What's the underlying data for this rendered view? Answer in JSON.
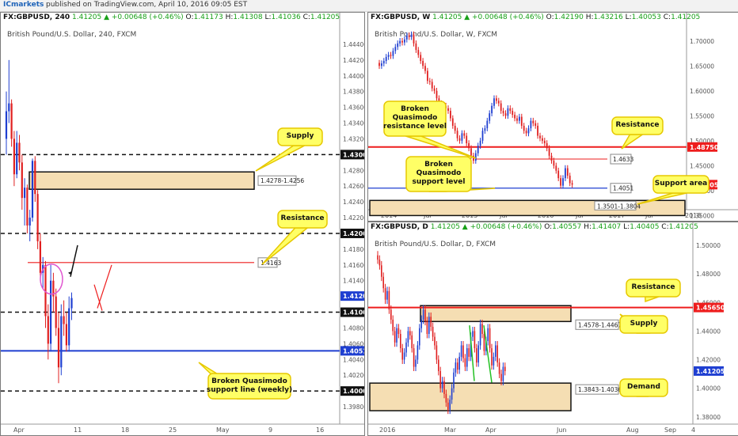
{
  "header": {
    "brand": "ICmarkets",
    "published_text": "published on TradingView.com, April 10, 2016 09:05 EST"
  },
  "colors": {
    "bull": "#1f3fd1",
    "bear": "#e02020",
    "zone_fill": "#f5deb3",
    "callout_fill": "#ffff66",
    "callout_border": "#e6c800",
    "resistance": "#ee1d1d",
    "support": "#1f3fd1"
  },
  "chart_data": [
    {
      "type": "candlestick",
      "ohlc_header": {
        "symbol": "FX:GBPUSD, 240",
        "change": "1.41205 ▲ +0.00648 (+0.46%)",
        "o": "1.41173",
        "h": "1.41308",
        "l": "1.41036",
        "c": "1.41205"
      },
      "title": "British Pound/U.S. Dollar, 240, FXCM",
      "ylim": [
        1.396,
        1.446
      ],
      "y_ticks": [
        "1.44400",
        "1.44200",
        "1.44000",
        "1.43800",
        "1.43600",
        "1.43400",
        "1.43200",
        "1.43000",
        "1.42800",
        "1.42600",
        "1.42400",
        "1.42200",
        "1.42000",
        "1.41800",
        "1.41600",
        "1.41400",
        "1.41205",
        "1.41000",
        "1.40800",
        "1.40600",
        "1.40510",
        "1.40400",
        "1.40200",
        "1.40000",
        "1.39800"
      ],
      "x_ticks": [
        "Apr",
        "11",
        "18",
        "25",
        "May",
        "9",
        "16"
      ],
      "levels": [
        {
          "label": "1.43000",
          "value": 1.43,
          "style": "dashed-black"
        },
        {
          "label": "1.42000",
          "value": 1.42,
          "style": "dashed-black"
        },
        {
          "label": "1.41000",
          "value": 1.41,
          "style": "dashed-black"
        },
        {
          "label": "1.40000",
          "value": 1.4,
          "style": "dashed-black"
        },
        {
          "label": "1.40510",
          "value": 1.4051,
          "style": "solid-blue"
        },
        {
          "label": "1.4163",
          "value": 1.4163,
          "style": "solid-red"
        }
      ],
      "zone": {
        "label": "1.4278-1.4256",
        "from": 1.4278,
        "to": 1.4256
      },
      "callouts": [
        "Supply",
        "Resistance",
        "Broken Quasimodo support line (weekly)"
      ],
      "current_price": "1.41205",
      "candles": [
        [
          1.432,
          1.438,
          1.43,
          1.4355
        ],
        [
          1.4355,
          1.442,
          1.434,
          1.4365
        ],
        [
          1.4365,
          1.437,
          1.431,
          1.432
        ],
        [
          1.432,
          1.433,
          1.426,
          1.4275
        ],
        [
          1.4275,
          1.433,
          1.427,
          1.4315
        ],
        [
          1.4315,
          1.4325,
          1.428,
          1.429
        ],
        [
          1.429,
          1.43,
          1.423,
          1.4245
        ],
        [
          1.4245,
          1.427,
          1.421,
          1.4258
        ],
        [
          1.4258,
          1.4262,
          1.42,
          1.421
        ],
        [
          1.421,
          1.423,
          1.419,
          1.422
        ],
        [
          1.422,
          1.4295,
          1.4215,
          1.4292
        ],
        [
          1.4292,
          1.4298,
          1.424,
          1.425
        ],
        [
          1.425,
          1.4255,
          1.418,
          1.419
        ],
        [
          1.419,
          1.42,
          1.414,
          1.415
        ],
        [
          1.415,
          1.417,
          1.413,
          1.416
        ],
        [
          1.416,
          1.4165,
          1.408,
          1.4095
        ],
        [
          1.4095,
          1.411,
          1.404,
          1.406
        ],
        [
          1.406,
          1.416,
          1.405,
          1.414
        ],
        [
          1.414,
          1.415,
          1.41,
          1.412
        ],
        [
          1.412,
          1.413,
          1.407,
          1.408
        ],
        [
          1.408,
          1.41,
          1.401,
          1.403
        ],
        [
          1.403,
          1.411,
          1.402,
          1.4095
        ],
        [
          1.4095,
          1.4115,
          1.407,
          1.4085
        ],
        [
          1.4085,
          1.41,
          1.405,
          1.4058
        ],
        [
          1.4058,
          1.412,
          1.405,
          1.4105
        ],
        [
          1.4105,
          1.4125,
          1.409,
          1.4118
        ]
      ]
    },
    {
      "type": "candlestick",
      "ohlc_header": {
        "symbol": "FX:GBPUSD, W",
        "change": "1.41205 ▲ +0.00648 (+0.46%)",
        "o": "1.42190",
        "h": "1.43216",
        "l": "1.40053",
        "c": "1.41205"
      },
      "title": "British Pound/U.S. Dollar, W, FXCM",
      "ylim": [
        1.365,
        1.725
      ],
      "y_ticks": [
        "1.70000",
        "1.65000",
        "1.60000",
        "1.55000",
        "1.50000",
        "1.45000",
        "1.40000",
        "1.35000"
      ],
      "x_ticks": [
        "2014",
        "Jul",
        "2015",
        "Jul",
        "2016",
        "Jul",
        "2017",
        "Jul",
        "2018"
      ],
      "levels": [
        {
          "label": "1.48750",
          "value": 1.4875,
          "style": "solid-red"
        },
        {
          "label": "1.4633",
          "value": 1.4633,
          "style": "thin-red"
        },
        {
          "label": "1.4051",
          "value": 1.4051,
          "style": "solid-blue"
        }
      ],
      "zone": {
        "label": "1.3501-1.3804",
        "from": 1.3804,
        "to": 1.3501
      },
      "callouts": [
        "Broken Quasimodo resistance level",
        "Resistance",
        "Broken Quasimodo support level",
        "Support area"
      ],
      "current_price": "1.41205",
      "closes": [
        1.65,
        1.655,
        1.66,
        1.668,
        1.672,
        1.67,
        1.68,
        1.688,
        1.695,
        1.7,
        1.697,
        1.703,
        1.711,
        1.708,
        1.713,
        1.695,
        1.682,
        1.672,
        1.66,
        1.65,
        1.64,
        1.62,
        1.618,
        1.605,
        1.6,
        1.585,
        1.575,
        1.56,
        1.57,
        1.565,
        1.56,
        1.545,
        1.53,
        1.52,
        1.505,
        1.5,
        1.515,
        1.51,
        1.495,
        1.485,
        1.47,
        1.46,
        1.475,
        1.49,
        1.5,
        1.52,
        1.525,
        1.54,
        1.555,
        1.57,
        1.585,
        1.58,
        1.575,
        1.56,
        1.555,
        1.55,
        1.565,
        1.56,
        1.552,
        1.545,
        1.54,
        1.548,
        1.53,
        1.52,
        1.515,
        1.525,
        1.54,
        1.535,
        1.53,
        1.51,
        1.505,
        1.5,
        1.495,
        1.485,
        1.47,
        1.46,
        1.45,
        1.44,
        1.425,
        1.41,
        1.425,
        1.445,
        1.43,
        1.415,
        1.412
      ]
    },
    {
      "type": "candlestick",
      "ohlc_header": {
        "symbol": "FX:GBPUSD, D",
        "change": "1.41205 ▲ +0.00648 (+0.46%)",
        "o": "1.40557",
        "h": "1.41407",
        "l": "1.40405",
        "c": "1.41205"
      },
      "title": "British Pound/U.S. Dollar, D, FXCM",
      "ylim": [
        1.376,
        1.505
      ],
      "y_ticks": [
        "1.50000",
        "1.48000",
        "1.46000",
        "1.44000",
        "1.42000",
        "1.40000",
        "1.38000"
      ],
      "x_ticks": [
        "2016",
        "Mar",
        "Apr",
        "Jun",
        "Aug",
        "Sep",
        "4"
      ],
      "levels": [
        {
          "label": "1.45650",
          "value": 1.4565,
          "style": "solid-red"
        }
      ],
      "zones": [
        {
          "label": "1.4578-1.4467",
          "from": 1.4578,
          "to": 1.4467
        },
        {
          "label": "1.3843-1.4036",
          "from": 1.4036,
          "to": 1.3843
        }
      ],
      "callouts": [
        "Resistance",
        "Supply",
        "Demand"
      ],
      "current_price": "1.41205",
      "closes": [
        1.49,
        1.486,
        1.478,
        1.47,
        1.462,
        1.468,
        1.455,
        1.448,
        1.44,
        1.432,
        1.442,
        1.438,
        1.428,
        1.42,
        1.425,
        1.432,
        1.44,
        1.437,
        1.428,
        1.415,
        1.42,
        1.43,
        1.442,
        1.448,
        1.455,
        1.447,
        1.438,
        1.45,
        1.443,
        1.436,
        1.43,
        1.42,
        1.412,
        1.4,
        1.405,
        1.396,
        1.39,
        1.385,
        1.392,
        1.4,
        1.411,
        1.418,
        1.413,
        1.422,
        1.43,
        1.421,
        1.415,
        1.428,
        1.422,
        1.436,
        1.44,
        1.428,
        1.418,
        1.43,
        1.445,
        1.438,
        1.426,
        1.433,
        1.442,
        1.428,
        1.416,
        1.422,
        1.43,
        1.418,
        1.41,
        1.405,
        1.415,
        1.412
      ]
    }
  ]
}
